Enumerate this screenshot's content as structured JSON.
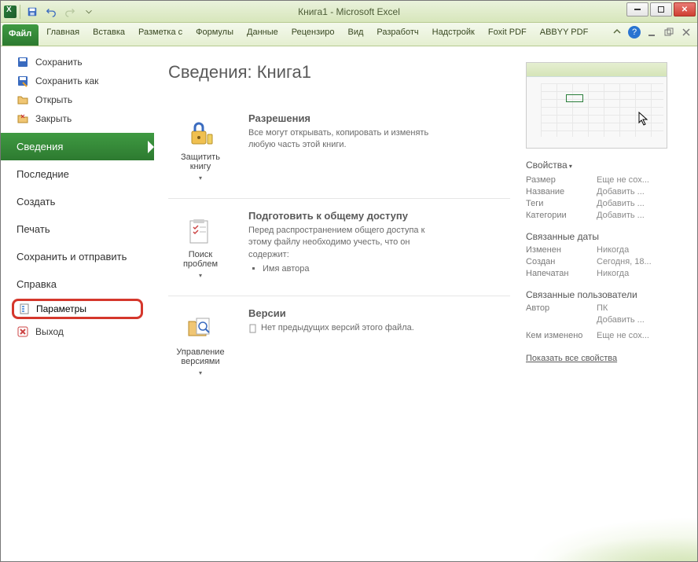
{
  "window": {
    "title": "Книга1  -  Microsoft Excel"
  },
  "ribbon": {
    "file": "Файл",
    "tabs": [
      "Главная",
      "Вставка",
      "Разметка с",
      "Формулы",
      "Данные",
      "Рецензиро",
      "Вид",
      "Разработч",
      "Надстройк",
      "Foxit PDF",
      "ABBYY PDF"
    ]
  },
  "sidebar": {
    "save": "Сохранить",
    "save_as": "Сохранить как",
    "open": "Открыть",
    "close": "Закрыть",
    "info": "Сведения",
    "recent": "Последние",
    "new": "Создать",
    "print": "Печать",
    "share": "Сохранить и отправить",
    "help": "Справка",
    "options": "Параметры",
    "exit": "Выход"
  },
  "page": {
    "title": "Сведения: Книга1",
    "permissions": {
      "btn": "Защитить книгу",
      "head": "Разрешения",
      "body": "Все могут открывать, копировать и изменять любую часть этой книги."
    },
    "prepare": {
      "btn": "Поиск проблем",
      "head": "Подготовить к общему доступу",
      "body": "Перед распространением общего доступа к этому файлу необходимо учесть, что он содержит:",
      "item1": "Имя автора"
    },
    "versions": {
      "btn": "Управление версиями",
      "head": "Версии",
      "body": "Нет предыдущих версий этого файла."
    }
  },
  "props": {
    "head": "Свойства",
    "size_l": "Размер",
    "size_v": "Еще не сох...",
    "title_l": "Название",
    "title_v": "Добавить ...",
    "tags_l": "Теги",
    "tags_v": "Добавить ...",
    "cat_l": "Категории",
    "cat_v": "Добавить ...",
    "dates_head": "Связанные даты",
    "mod_l": "Изменен",
    "mod_v": "Никогда",
    "created_l": "Создан",
    "created_v": "Сегодня, 18...",
    "printed_l": "Напечатан",
    "printed_v": "Никогда",
    "users_head": "Связанные пользователи",
    "author_l": "Автор",
    "author_v": "ПК",
    "author_add": "Добавить ...",
    "changed_l": "Кем изменено",
    "changed_v": "Еще не сох...",
    "show_all": "Показать все свойства"
  }
}
